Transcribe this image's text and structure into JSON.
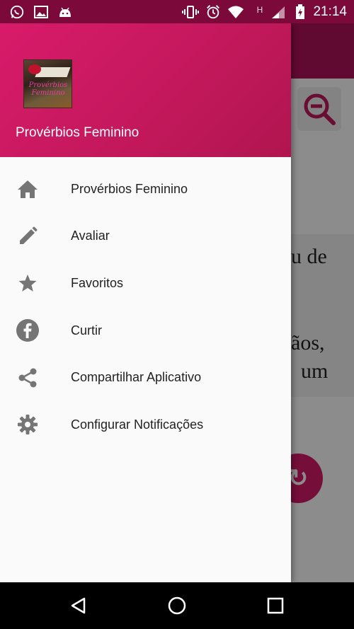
{
  "status_bar": {
    "time": "21:14",
    "background": "#7b0a3b",
    "left_icons": [
      "whatsapp-icon",
      "image-icon",
      "android-icon"
    ],
    "right_icons": [
      "vibrate-icon",
      "alarm-icon",
      "wifi-icon",
      "signal-icon",
      "battery-charging-icon"
    ],
    "network_letter": "H"
  },
  "background_app": {
    "app_bar_color": "#b0125a",
    "text_fragments": [
      "u de",
      "ãos,",
      "um"
    ],
    "fab_icon": "refresh-icon"
  },
  "drawer": {
    "header": {
      "title": "Provérbios Feminino",
      "gradient": [
        "#d81b6a",
        "#b0154f"
      ],
      "logo_text": "Provérbios Feminino"
    },
    "items": [
      {
        "label": "Provérbios Feminino",
        "icon": "home-icon"
      },
      {
        "label": "Avaliar",
        "icon": "pencil-icon"
      },
      {
        "label": "Favoritos",
        "icon": "star-icon"
      },
      {
        "label": "Curtir",
        "icon": "facebook-icon"
      },
      {
        "label": "Compartilhar Aplicativo",
        "icon": "share-icon"
      },
      {
        "label": "Configurar Notificações",
        "icon": "gear-icon"
      }
    ]
  },
  "nav_bar": {
    "buttons": [
      "back-icon",
      "home-circle-icon",
      "recents-icon"
    ]
  }
}
